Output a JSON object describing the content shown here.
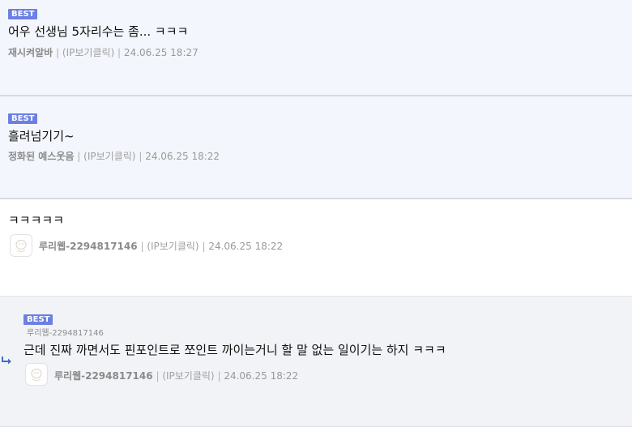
{
  "comments": [
    {
      "badge": "BEST",
      "text": "어우 선생님 5자리수는 좀... ㅋㅋㅋ",
      "author": "재시켜알바",
      "ip_link": "(IP보기클릭)",
      "separator": "|",
      "timestamp": "24.06.25 18:27"
    },
    {
      "badge": "BEST",
      "text": "흘려넘기기~",
      "author": "정화된 예스웃음",
      "ip_link": "(IP보기클릭)",
      "separator": "|",
      "timestamp": "24.06.25 18:22"
    },
    {
      "text": "ㅋㅋㅋㅋㅋ",
      "author": "루리웹-2294817146",
      "ip_link": "(IP보기클릭)",
      "separator": "|",
      "timestamp": "24.06.25 18:22"
    },
    {
      "badge": "BEST",
      "reply_to": "루리웹-2294817146",
      "text": "근데 진짜 까면서도 핀포인트로 쪼인트 까이는거니 할 말 없는 일이기는 하지 ㅋㅋㅋ",
      "author": "루리웹-2294817146",
      "ip_link": "(IP보기클릭)",
      "separator": "|",
      "timestamp": "24.06.25 18:22"
    }
  ],
  "colors": {
    "best_badge": "#6c7fe3",
    "best_background": "#f4f6fd",
    "reply_background": "#f2f3f6",
    "reply_arrow": "#3f6fc6"
  },
  "icons": {
    "avatar": "default-avatar-icon",
    "reply": "reply-arrow-icon"
  }
}
